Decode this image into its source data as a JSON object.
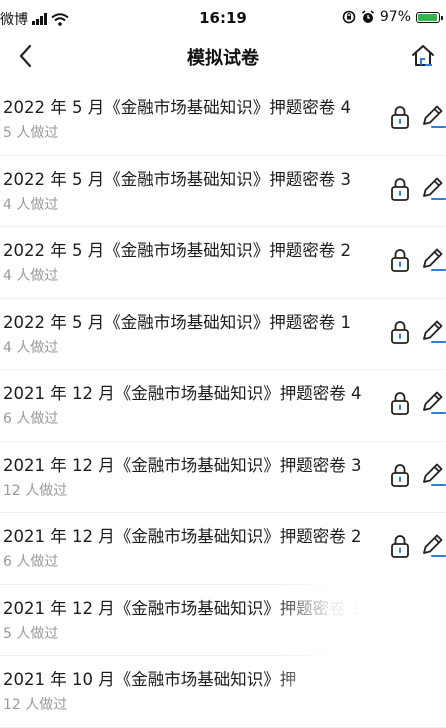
{
  "status_bar": {
    "carrier": "微博",
    "time": "16:19",
    "battery": "97%"
  },
  "nav": {
    "title": "模拟试卷"
  },
  "papers": [
    {
      "title": "2022 年 5 月《金融市场基础知识》押题密卷 4",
      "done": "5 人做过"
    },
    {
      "title": "2022 年 5 月《金融市场基础知识》押题密卷 3",
      "done": "4 人做过"
    },
    {
      "title": "2022 年 5 月《金融市场基础知识》押题密卷 2",
      "done": "4 人做过"
    },
    {
      "title": "2022 年 5 月《金融市场基础知识》押题密卷 1",
      "done": "4 人做过"
    },
    {
      "title": "2021 年 12 月《金融市场基础知识》押题密卷 4",
      "done": "6 人做过"
    },
    {
      "title": "2021 年 12 月《金融市场基础知识》押题密卷 3",
      "done": "12 人做过"
    },
    {
      "title": "2021 年 12 月《金融市场基础知识》押题密卷 2",
      "done": "6 人做过"
    },
    {
      "title": "2021 年 12 月《金融市场基础知识》押题密卷 1",
      "done": "5 人做过"
    },
    {
      "title": "2021 年 10 月《金融市场基础知识》押",
      "done": "12 人做过"
    }
  ],
  "colors": {
    "accent_blue": "#2a7de1",
    "battery_green": "#2fb84b"
  }
}
